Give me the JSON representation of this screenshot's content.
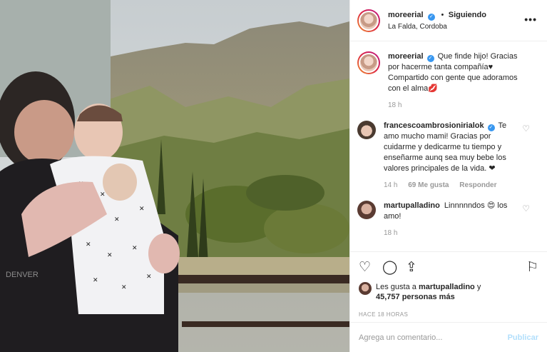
{
  "post": {
    "author": "moreerial",
    "follow_separator": "•",
    "follow_status": "Siguiendo",
    "location": "La Falda, Cordoba",
    "more_label": "•••",
    "photo_text": "DENVER"
  },
  "comments": [
    {
      "user": "moreerial",
      "verified": true,
      "text": "Que finde hijo! Gracias por hacerme tanta compañía♥ Compartido con gente que adoramos con el alma💋",
      "time": "18 h"
    },
    {
      "user": "francescoambrosionirialok",
      "verified": true,
      "text": "Te amo mucho mami! Gracias por cuidarme y dedicarme tu tiempo y enseñarme aunq sea muy bebe los valores principales de la vida. ❤",
      "time": "14 h",
      "likes": "69 Me gusta",
      "reply": "Responder"
    },
    {
      "user": "martupalladino",
      "verified": false,
      "text": "Linnnnndos 😍 los amo!",
      "time": "18 h"
    }
  ],
  "actions": {
    "liked_by_prefix": "Les gusta a",
    "liked_by_user": "martupalladino",
    "liked_by_suffix": "y",
    "likes_count": "45,757 personas más",
    "time_ago": "HACE 18 HORAS"
  },
  "add_comment": {
    "placeholder": "Agrega un comentario...",
    "publish_label": "Publicar"
  },
  "colors": {
    "verified": "#3897f0",
    "publish_disabled": "#b2dffc",
    "muted_text": "#999999"
  }
}
